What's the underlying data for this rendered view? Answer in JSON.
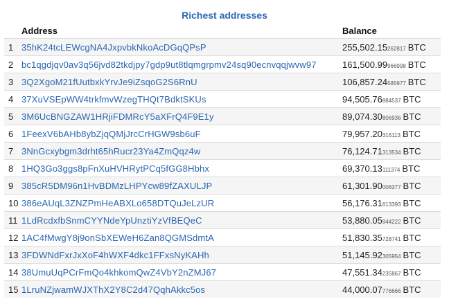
{
  "title": "Richest addresses",
  "columns": {
    "address": "Address",
    "balance": "Balance"
  },
  "rows": [
    {
      "rank": "1",
      "address": "35hK24tcLEWcgNA4JxpvbkNkoAcDGqQPsP",
      "balance_main": "255,502.15",
      "balance_small": "262817",
      "unit": "BTC"
    },
    {
      "rank": "2",
      "address": "bc1qgdjqv0av3q56jvd82tkdjpy7gdp9ut8tlqmgrpmv24sq90ecnvqqjwvw97",
      "balance_main": "161,500.99",
      "balance_small": "966998",
      "unit": "BTC"
    },
    {
      "rank": "3",
      "address": "3Q2XgoM21fUutbxkYrvJe9iZsqoG2S6RnU",
      "balance_main": "106,857.24",
      "balance_small": "585977",
      "unit": "BTC"
    },
    {
      "rank": "4",
      "address": "37XuVSEpWW4trkfmvWzegTHQt7BdktSKUs",
      "balance_main": "94,505.76",
      "balance_small": "884537",
      "unit": "BTC"
    },
    {
      "rank": "5",
      "address": "3M6UcBNGZAW1HRjiFDMRcY5aXFrQ4F9E1y",
      "balance_main": "89,074.30",
      "balance_small": "806936",
      "unit": "BTC"
    },
    {
      "rank": "6",
      "address": "1FeexV6bAHb8ybZjqQMjJrcCrHGW9sb6uF",
      "balance_main": "79,957.20",
      "balance_small": "316113",
      "unit": "BTC"
    },
    {
      "rank": "7",
      "address": "3NnGcxybgm3drht65hRucr23Ya4ZmQqz4w",
      "balance_main": "76,124.71",
      "balance_small": "313534",
      "unit": "BTC"
    },
    {
      "rank": "8",
      "address": "1HQ3Go3ggs8pFnXuHVHRytPCq5fGG8Hbhx",
      "balance_main": "69,370.13",
      "balance_small": "111374",
      "unit": "BTC"
    },
    {
      "rank": "9",
      "address": "385cR5DM96n1HvBDMzLHPYcw89fZAXULJP",
      "balance_main": "61,301.90",
      "balance_small": "008377",
      "unit": "BTC"
    },
    {
      "rank": "10",
      "address": "386eAUqL3ZNZPmHeABXLo658DTQuJeLzUR",
      "balance_main": "56,176.31",
      "balance_small": "613393",
      "unit": "BTC"
    },
    {
      "rank": "11",
      "address": "1LdRcdxfbSnmCYYNdeYpUnztiYzVfBEQeC",
      "balance_main": "53,880.05",
      "balance_small": "944222",
      "unit": "BTC"
    },
    {
      "rank": "12",
      "address": "1AC4fMwgY8j9onSbXEWeH6Zan8QGMSdmtA",
      "balance_main": "51,830.35",
      "balance_small": "728741",
      "unit": "BTC"
    },
    {
      "rank": "13",
      "address": "3FDWNdFxrJxXoF4hWXF4dkc1FFxsNyKAHh",
      "balance_main": "51,145.92",
      "balance_small": "305954",
      "unit": "BTC"
    },
    {
      "rank": "14",
      "address": "38UmuUqPCrFmQo4khkomQwZ4VbY2nZMJ67",
      "balance_main": "47,551.34",
      "balance_small": "235867",
      "unit": "BTC"
    },
    {
      "rank": "15",
      "address": "1LruNZjwamWJXThX2Y8C2d47QqhAkkc5os",
      "balance_main": "44,000.07",
      "balance_small": "776666",
      "unit": "BTC"
    }
  ]
}
